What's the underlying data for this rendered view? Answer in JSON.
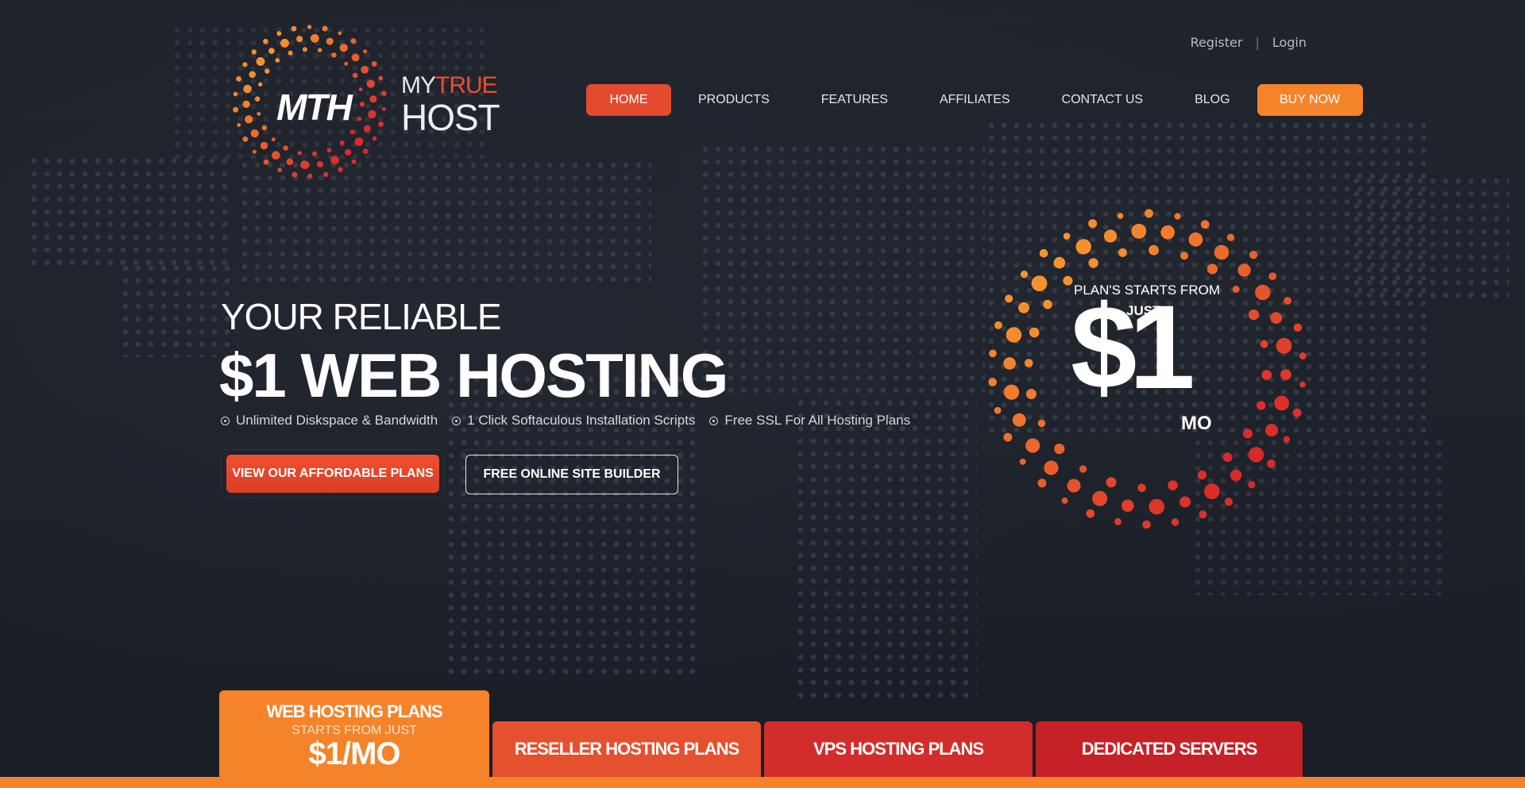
{
  "brand": {
    "mark": "MTH",
    "name_part1": "MY",
    "name_part2": "TRUE",
    "name_part3": "HOST",
    "accent": "#e8502e",
    "orange": "#f5832a"
  },
  "top_links": {
    "register": "Register",
    "separator": "|",
    "login": "Login"
  },
  "nav": {
    "items": [
      {
        "label": "HOME",
        "active": true
      },
      {
        "label": "PRODUCTS"
      },
      {
        "label": "FEATURES"
      },
      {
        "label": "AFFILIATES"
      },
      {
        "label": "CONTACT US"
      },
      {
        "label": "BLOG"
      }
    ],
    "buy_now": "BUY NOW"
  },
  "hero": {
    "subtitle": "YOUR RELIABLE",
    "title": "$1 WEB HOSTING",
    "features": [
      "Unlimited Diskspace & Bandwidth",
      "1 Click Softaculous Installation Scripts",
      "Free SSL For All Hosting Plans"
    ],
    "cta_primary": "VIEW OUR AFFORDABLE PLANS",
    "cta_secondary": "FREE ONLINE SITE BUILDER"
  },
  "price_badge": {
    "label": "PLAN'S STARTS FROM",
    "just": "JUST",
    "amount": "$1",
    "period": "MO"
  },
  "plan_tabs": [
    {
      "title": "WEB HOSTING PLANS",
      "subtitle": "STARTS FROM JUST",
      "price": "$1/MO",
      "color": "#f5832a",
      "active": true
    },
    {
      "title": "RESELLER HOSTING PLANS",
      "color": "#e5502f"
    },
    {
      "title": "VPS HOSTING PLANS",
      "color": "#d22d2b"
    },
    {
      "title": "DEDICATED SERVERS",
      "color": "#c52126"
    }
  ]
}
